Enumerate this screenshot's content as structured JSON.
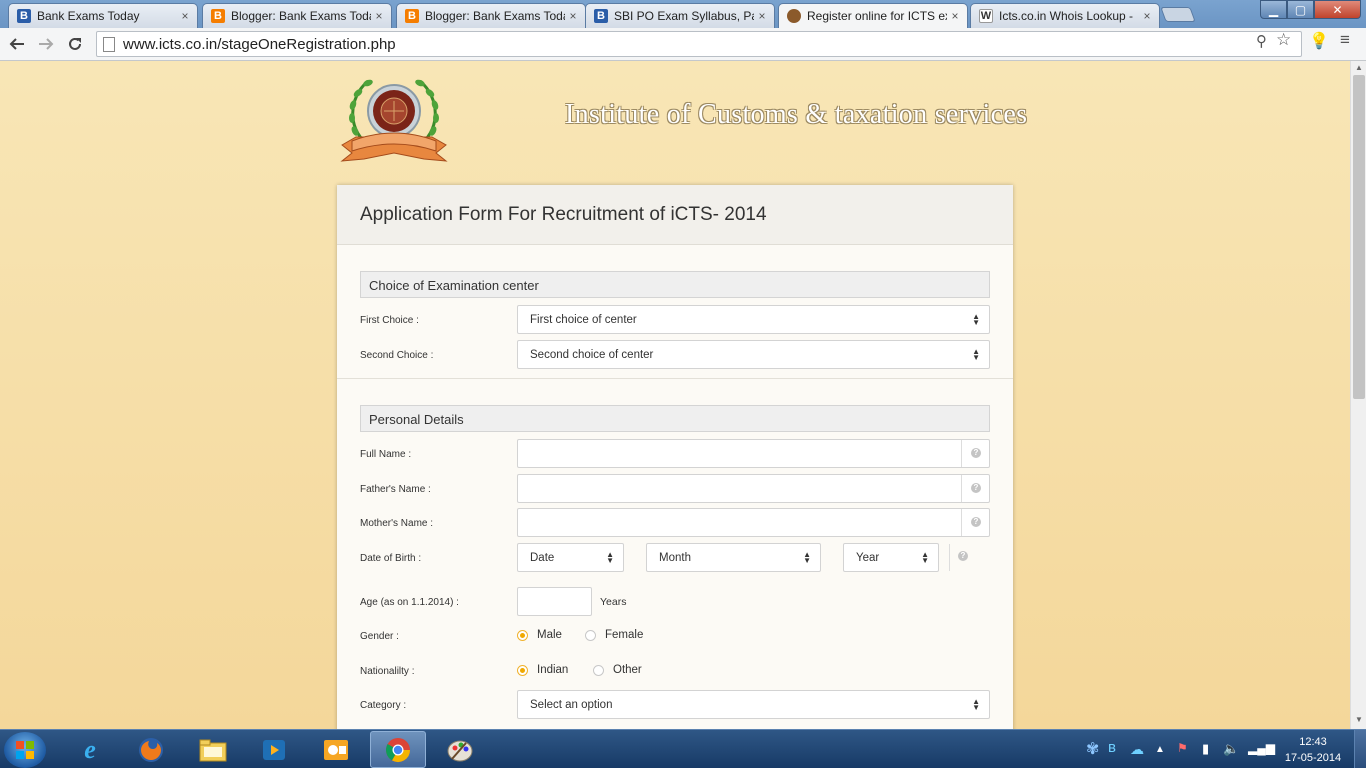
{
  "browser": {
    "tabs": [
      {
        "title": "Bank Exams Today",
        "favicon": "B",
        "favicon_color": "#2a5da8",
        "active": false
      },
      {
        "title": "Blogger: Bank Exams Toda",
        "favicon": "B",
        "favicon_color": "#f57d00",
        "active": false
      },
      {
        "title": "Blogger: Bank Exams Toda",
        "favicon": "B",
        "favicon_color": "#f57d00",
        "active": false
      },
      {
        "title": "SBI PO Exam Syllabus, Patt",
        "favicon": "B",
        "favicon_color": "#2a5da8",
        "active": false
      },
      {
        "title": "Register online for ICTS ex",
        "favicon": "",
        "favicon_color": "#8b5a2b",
        "active": true
      },
      {
        "title": "Icts.co.in Whois Lookup -",
        "favicon": "W",
        "favicon_color": "#ffffff",
        "active": false
      }
    ],
    "close_glyph": "×",
    "url": "www.icts.co.in/stageOneRegistration.php",
    "window_buttons": {
      "minimize": "▁",
      "maximize": "▢",
      "close": "✕"
    }
  },
  "site": {
    "title": "Institute of Customs & taxation services",
    "logo_ribbon": "Institute of Customs & Taxation Services"
  },
  "form": {
    "heading": "Application Form For Recruitment of iCTS- 2014",
    "exam_center": {
      "section_title": "Choice of Examination center",
      "first_choice_label": "First Choice :",
      "first_choice_value": "First choice of center",
      "second_choice_label": "Second Choice :",
      "second_choice_value": "Second choice of center"
    },
    "personal": {
      "section_title": "Personal Details",
      "full_name_label": "Full Name :",
      "fathers_name_label": "Father's Name :",
      "mothers_name_label": "Mother's Name :",
      "dob_label": "Date of Birth :",
      "dob_date": "Date",
      "dob_month": "Month",
      "dob_year": "Year",
      "age_label": "Age (as on 1.1.2014) :",
      "age_unit": "Years",
      "gender_label": "Gender :",
      "gender_male": "Male",
      "gender_female": "Female",
      "nationality_label": "Nationalilty :",
      "nationality_indian": "Indian",
      "nationality_other": "Other",
      "category_label": "Category :",
      "category_value": "Select an option"
    }
  },
  "taskbar": {
    "time": "12:43",
    "date": "17-05-2014"
  }
}
